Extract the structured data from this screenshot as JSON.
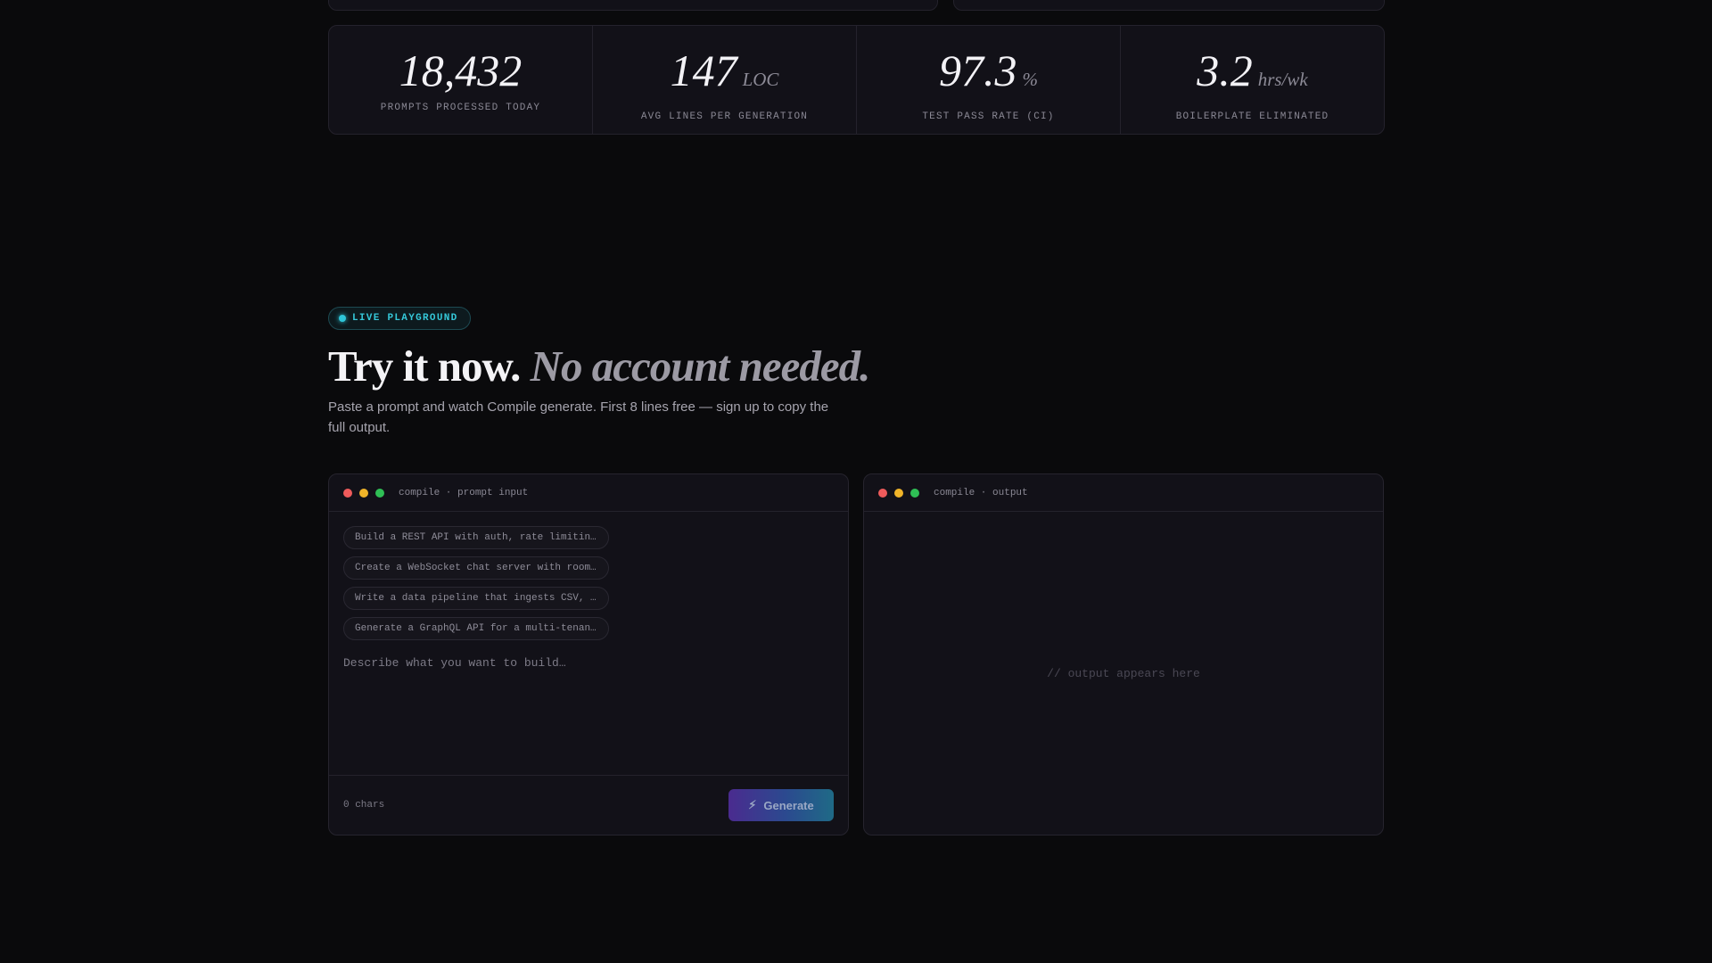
{
  "stats": [
    {
      "value": "18,432",
      "unit": "",
      "label": "PROMPTS PROCESSED TODAY"
    },
    {
      "value": "147",
      "unit": "LOC",
      "label": "AVG LINES PER GENERATION"
    },
    {
      "value": "97.3",
      "unit": "%",
      "label": "TEST PASS RATE (CI)"
    },
    {
      "value": "3.2",
      "unit": "hrs/wk",
      "label": "BOILERPLATE ELIMINATED"
    }
  ],
  "playground": {
    "badge": "LIVE PLAYGROUND",
    "headline": "Try it now.",
    "headline_accent": "No account needed.",
    "subcopy": "Paste a prompt and watch Compile generate. First 8 lines free — sign up to copy the full output."
  },
  "input_panel": {
    "title": "compile · prompt input",
    "chips": [
      "Build a REST API with auth, rate limiting, and OpenAPI docs",
      "Create a WebSocket chat server with rooms and presence",
      "Write a data pipeline that ingests CSV, validates rows, and loads to Postgres",
      "Generate a GraphQL API for a multi-tenant SaaS app"
    ],
    "placeholder": "Describe what you want to build…",
    "char_count": "0 chars",
    "generate_label": "Generate"
  },
  "output_panel": {
    "title": "compile · output",
    "placeholder": "// output appears here"
  },
  "colors": {
    "accent_cyan": "#2ec5d8",
    "background": "#0a0a0c",
    "panel": "#121118"
  },
  "icons": {
    "badge": "live-dot-icon",
    "generate": "lightning-bolt-icon"
  }
}
